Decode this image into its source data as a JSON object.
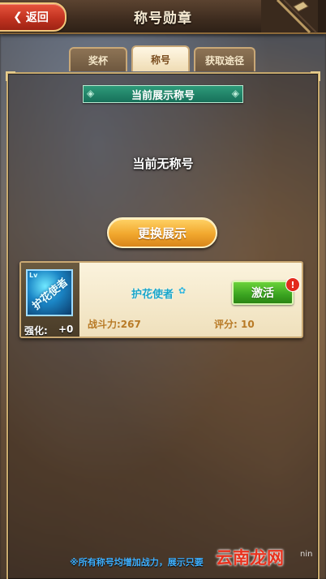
{
  "header": {
    "back_label": "返回",
    "title": "称号勋章"
  },
  "tabs": [
    {
      "label": "奖杯",
      "active": false
    },
    {
      "label": "称号",
      "active": true
    },
    {
      "label": "获取途径",
      "active": false
    }
  ],
  "section": {
    "banner_title": "当前展示称号",
    "empty_text": "当前无称号",
    "swap_button": "更换展示"
  },
  "title_card": {
    "icon": "title-medal-icon",
    "icon_text": "护花使者",
    "icon_level": "Lv",
    "enhance_label": "强化:",
    "enhance_value": "+0",
    "title_name": "护花使者",
    "activate_label": "激活",
    "alert_mark": "!",
    "power": "战斗力:267",
    "score": "评分: 10"
  },
  "footer": {
    "note": "※所有称号均增加战力，展示只要"
  },
  "watermark": {
    "text": "云南龙网",
    "sub": "nin"
  },
  "colors": {
    "back_button": "#c13220",
    "banner": "#17705a",
    "swap_button": "#f1a72d",
    "activate_button": "#3aa420",
    "alert": "#e32a1c",
    "stat_text": "#b87a26",
    "note_text": "#3fb0ff"
  }
}
